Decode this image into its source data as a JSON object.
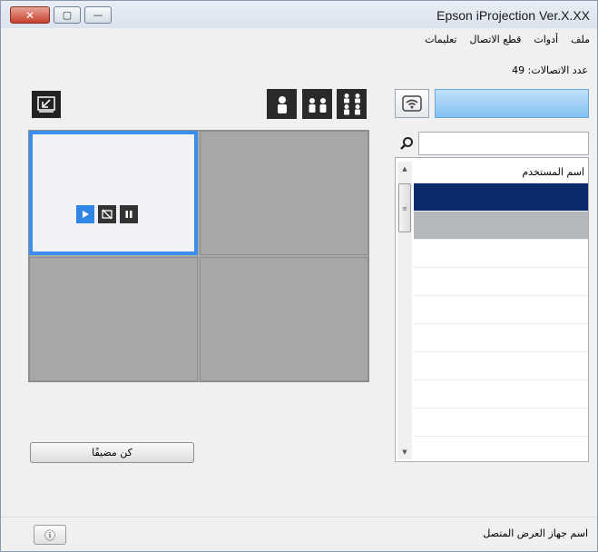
{
  "window": {
    "title": "Epson iProjection Ver.X.XX",
    "close_glyph": "✕",
    "maximize_glyph": "▢",
    "minimize_glyph": "—"
  },
  "menu": [
    "ملف",
    "أدوات",
    "قطع الاتصال",
    "تعليمات"
  ],
  "connections_label": "عدد الاتصالات: 49",
  "user_panel": {
    "selected_user": "",
    "search_placeholder": "",
    "list_header": "اسم المستخدم",
    "users": [
      "",
      "",
      "",
      "",
      "",
      "",
      "",
      "",
      "",
      ""
    ]
  },
  "grid": {
    "cells": [
      {
        "label": ""
      },
      {
        "label": ""
      },
      {
        "label": ""
      },
      {
        "label": ""
      }
    ]
  },
  "presenter_button": "كن مضيفًا",
  "status": {
    "label": "اسم جهاز العرض المتصل",
    "device_name": ""
  },
  "icons": {
    "info": "ⓘ"
  },
  "colors": {
    "accent": "#3b8ef0",
    "selected_dark": "#0b2a6b",
    "close_red": "#c8412c"
  }
}
